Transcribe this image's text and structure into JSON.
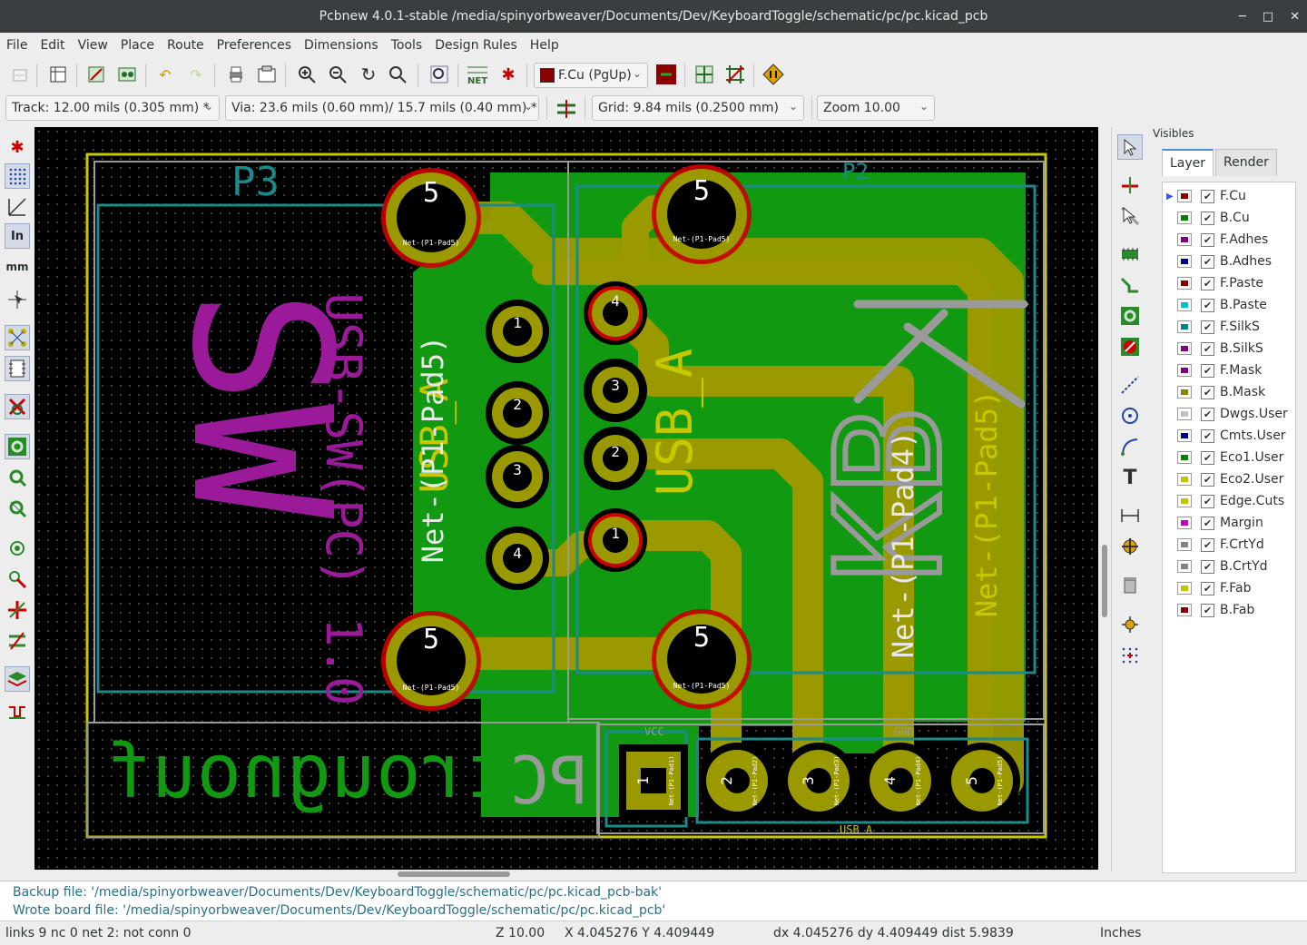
{
  "window": {
    "title": "Pcbnew 4.0.1-stable /media/spinyorbweaver/Documents/Dev/KeyboardToggle/schematic/pc/pc.kicad_pcb"
  },
  "menu": [
    "File",
    "Edit",
    "View",
    "Place",
    "Route",
    "Preferences",
    "Dimensions",
    "Tools",
    "Design Rules",
    "Help"
  ],
  "toolbar": {
    "layer_select": "F.Cu (PgUp)",
    "track": "Track: 12.00 mils (0.305 mm) *",
    "via": "Via: 23.6 mils (0.60 mm)/ 15.7 mils (0.40 mm) *",
    "grid": "Grid: 9.84 mils (0.2500 mm)",
    "zoom": "Zoom 10.00",
    "net_label": "NET"
  },
  "left_toolbar": {
    "units_in": "In",
    "units_mm": "mm"
  },
  "visibles": {
    "title": "Visibles",
    "tabs": [
      "Layer",
      "Render"
    ],
    "layers": [
      {
        "name": "F.Cu",
        "color": "#8b0000",
        "checked": true,
        "selected": true
      },
      {
        "name": "B.Cu",
        "color": "#008000",
        "checked": true
      },
      {
        "name": "F.Adhes",
        "color": "#840084",
        "checked": true
      },
      {
        "name": "B.Adhes",
        "color": "#000084",
        "checked": true
      },
      {
        "name": "F.Paste",
        "color": "#840000",
        "checked": true
      },
      {
        "name": "B.Paste",
        "color": "#00c2c2",
        "checked": true
      },
      {
        "name": "F.SilkS",
        "color": "#008484",
        "checked": true
      },
      {
        "name": "B.SilkS",
        "color": "#840084",
        "checked": true
      },
      {
        "name": "F.Mask",
        "color": "#840084",
        "checked": true
      },
      {
        "name": "B.Mask",
        "color": "#848400",
        "checked": true
      },
      {
        "name": "Dwgs.User",
        "color": "#c2c2c2",
        "checked": true
      },
      {
        "name": "Cmts.User",
        "color": "#000084",
        "checked": true
      },
      {
        "name": "Eco1.User",
        "color": "#008400",
        "checked": true
      },
      {
        "name": "Eco2.User",
        "color": "#c2c200",
        "checked": true
      },
      {
        "name": "Edge.Cuts",
        "color": "#c2c200",
        "checked": true
      },
      {
        "name": "Margin",
        "color": "#c200c2",
        "checked": true
      },
      {
        "name": "F.CrtYd",
        "color": "#848484",
        "checked": true
      },
      {
        "name": "B.CrtYd",
        "color": "#848484",
        "checked": true
      },
      {
        "name": "F.Fab",
        "color": "#c2c200",
        "checked": true
      },
      {
        "name": "B.Fab",
        "color": "#840000",
        "checked": true
      }
    ]
  },
  "pcb": {
    "ref_p3": "P3",
    "ref_p2": "P2",
    "silk_usb_sw": "USB-SW(PC) 1.0",
    "big_letters_b": "SW",
    "big_letters_f": "KB",
    "text_trough": "trougnouf",
    "text_pc": "PC",
    "net_usb_a": "USB_A",
    "net_left": "Net-(P1-Pad5)",
    "net_pad4": "Net-(P1-Pad4)",
    "net_pad5_right": "Net-(P1-Pad5)",
    "pad_small_net": "Net-(P1-Pad5)",
    "vcc": "VCC",
    "gnd": "GND",
    "usb_a_small": "USB_A",
    "pad_numbers": {
      "big": "5",
      "p3_1": "1",
      "p3_2": "2",
      "p3_3": "3",
      "p3_4": "4",
      "p2_4": "4",
      "p2_3": "3",
      "p2_2": "2",
      "p2_1": "1",
      "h1": "1",
      "h2": "2",
      "h3": "3",
      "h4": "4",
      "h5": "5"
    },
    "header_pad_nets": [
      "Net-(P1-Pad1)",
      "Net-(P1-Pad2)",
      "Net-(P1-Pad3)",
      "Net-(P1-Pad4)",
      "Net-(P1-Pad5)"
    ]
  },
  "messages": {
    "line1": "Backup file: '/media/spinyorbweaver/Documents/Dev/KeyboardToggle/schematic/pc/pc.kicad_pcb-bak'",
    "line2": "Wrote board file: '/media/spinyorbweaver/Documents/Dev/KeyboardToggle/schematic/pc/pc.kicad_pcb'"
  },
  "status": {
    "links": "links 9 nc 0  net 2: not conn 0",
    "zoom": "Z 10.00",
    "xy": "X 4.045276  Y 4.409449",
    "dxy": "dx 4.045276  dy 4.409449  dist 5.9839",
    "units": "Inches"
  }
}
